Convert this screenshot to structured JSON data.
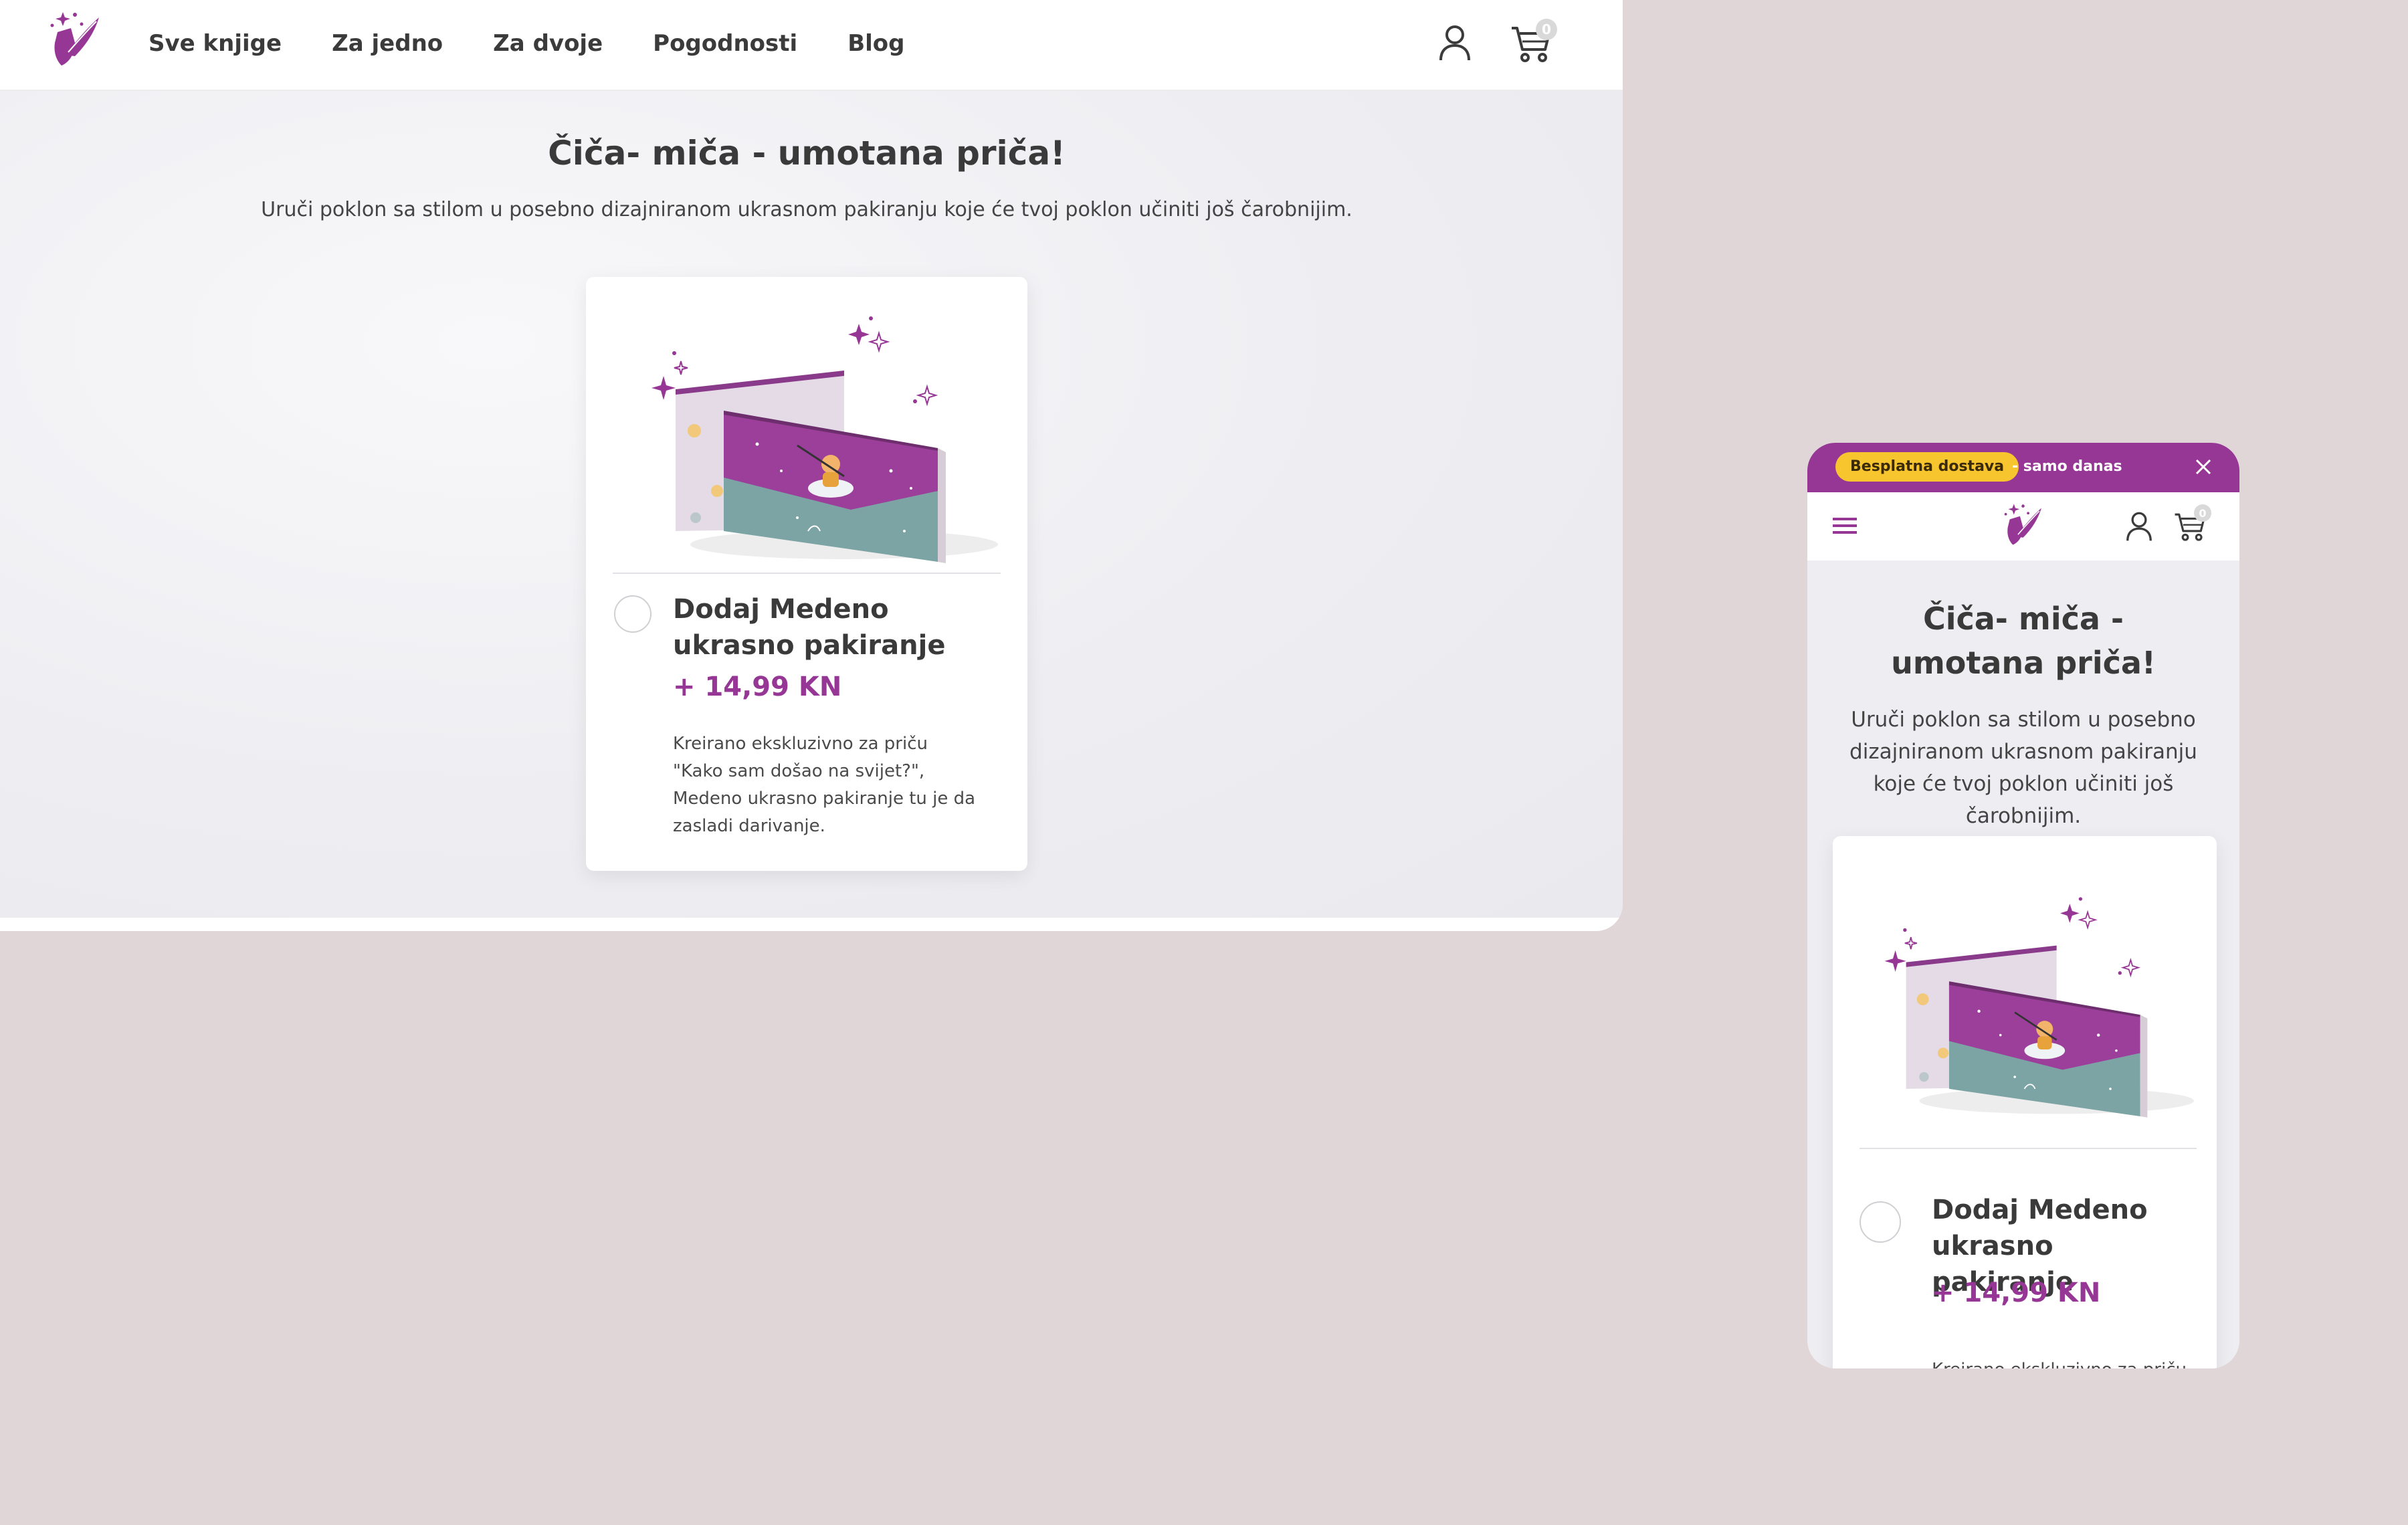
{
  "colors": {
    "brand_purple": "#963796",
    "promo_yellow": "#f7c52e",
    "text_dark": "#3a3a3a",
    "page_background": "#e0d5d7"
  },
  "header": {
    "logo_icon": "wizard-quill-logo-icon",
    "nav": [
      "Sve knjige",
      "Za jedno",
      "Za dvoje",
      "Pogodnosti",
      "Blog"
    ],
    "account_icon": "user-icon",
    "cart_icon": "cart-icon",
    "cart_count": "0"
  },
  "promo_bar": {
    "badge": "Besplatna  dostava",
    "text": "-  samo danas",
    "close_icon": "close-icon"
  },
  "mobile_header": {
    "menu_icon": "hamburger-menu-icon"
  },
  "section": {
    "title": "Čiča- miča - umotana priča!",
    "subtitle": "Uruči poklon sa stilom u posebno dizajniranom ukrasnom pakiranju koje će tvoj poklon učiniti još čarobnijim."
  },
  "product": {
    "image_icon": "gift-envelope-illustration",
    "title": "Dodaj Medeno ukrasno pakiranje",
    "price": "+ 14,99 KN",
    "description": "Kreirano ekskluzivno za priču \"Kako sam došao na svijet?\", Medeno ukrasno pakiranje tu je da zasladi darivanje."
  }
}
